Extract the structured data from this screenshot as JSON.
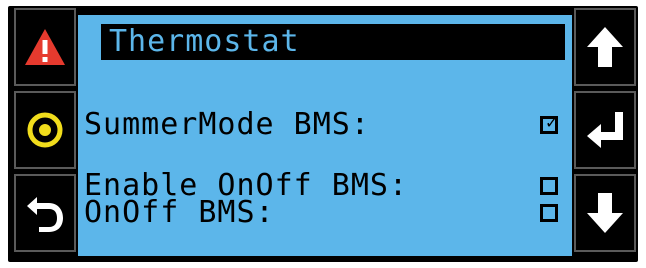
{
  "screen": {
    "title": "Thermostat",
    "rows": [
      {
        "label": "SummerMode BMS:",
        "checked": true
      },
      {
        "label": "Enable OnOff BMS:",
        "checked": false
      },
      {
        "label": "OnOff BMS:",
        "checked": false
      }
    ]
  },
  "left_keys": [
    "alarm-icon",
    "program-icon",
    "escape-icon"
  ],
  "right_keys": [
    "up-arrow-icon",
    "enter-icon",
    "down-arrow-icon"
  ],
  "colors": {
    "screen_bg": "#5cb6ea",
    "frame": "#000000",
    "alarm": "#e63a2e",
    "program": "#f1dd1c",
    "key_icon": "#ffffff"
  },
  "check_mark": "✓"
}
